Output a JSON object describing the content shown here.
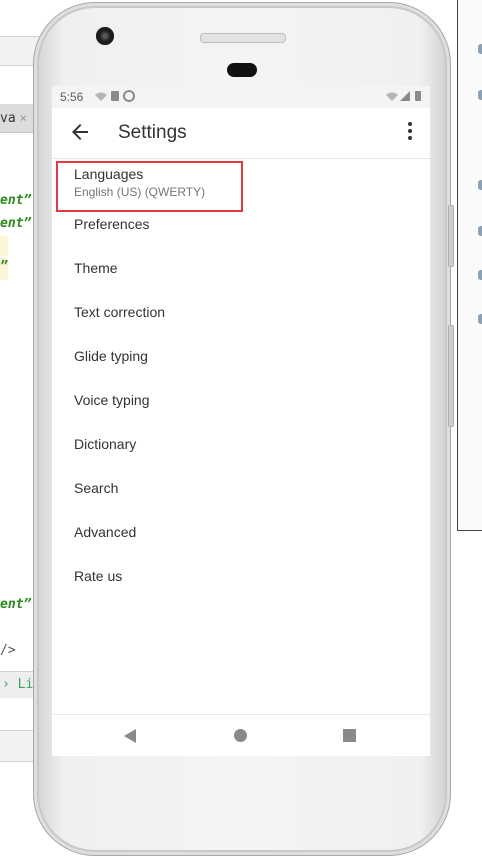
{
  "background": {
    "ide_tab_label": "va",
    "ide_tab_close": "×",
    "code_lines": [
      "ent”",
      "ent”",
      "”",
      "ent”"
    ],
    "closing_tag": "/>",
    "breadcrumb": "› Li"
  },
  "status_bar": {
    "time": "5:56"
  },
  "app_bar": {
    "title": "Settings",
    "back_icon": "arrow-back-icon",
    "more_icon": "more-vert-icon"
  },
  "settings": {
    "items": [
      {
        "label": "Languages",
        "sub": "English (US) (QWERTY)"
      },
      {
        "label": "Preferences"
      },
      {
        "label": "Theme"
      },
      {
        "label": "Text correction"
      },
      {
        "label": "Glide typing"
      },
      {
        "label": "Voice typing"
      },
      {
        "label": "Dictionary"
      },
      {
        "label": "Search"
      },
      {
        "label": "Advanced"
      },
      {
        "label": "Rate us"
      }
    ]
  },
  "nav_bar": {
    "back": "nav-back-icon",
    "home": "nav-home-icon",
    "recents": "nav-recents-icon"
  },
  "colors": {
    "highlight_border": "#e0393e",
    "code_green": "#2a8a1a"
  }
}
